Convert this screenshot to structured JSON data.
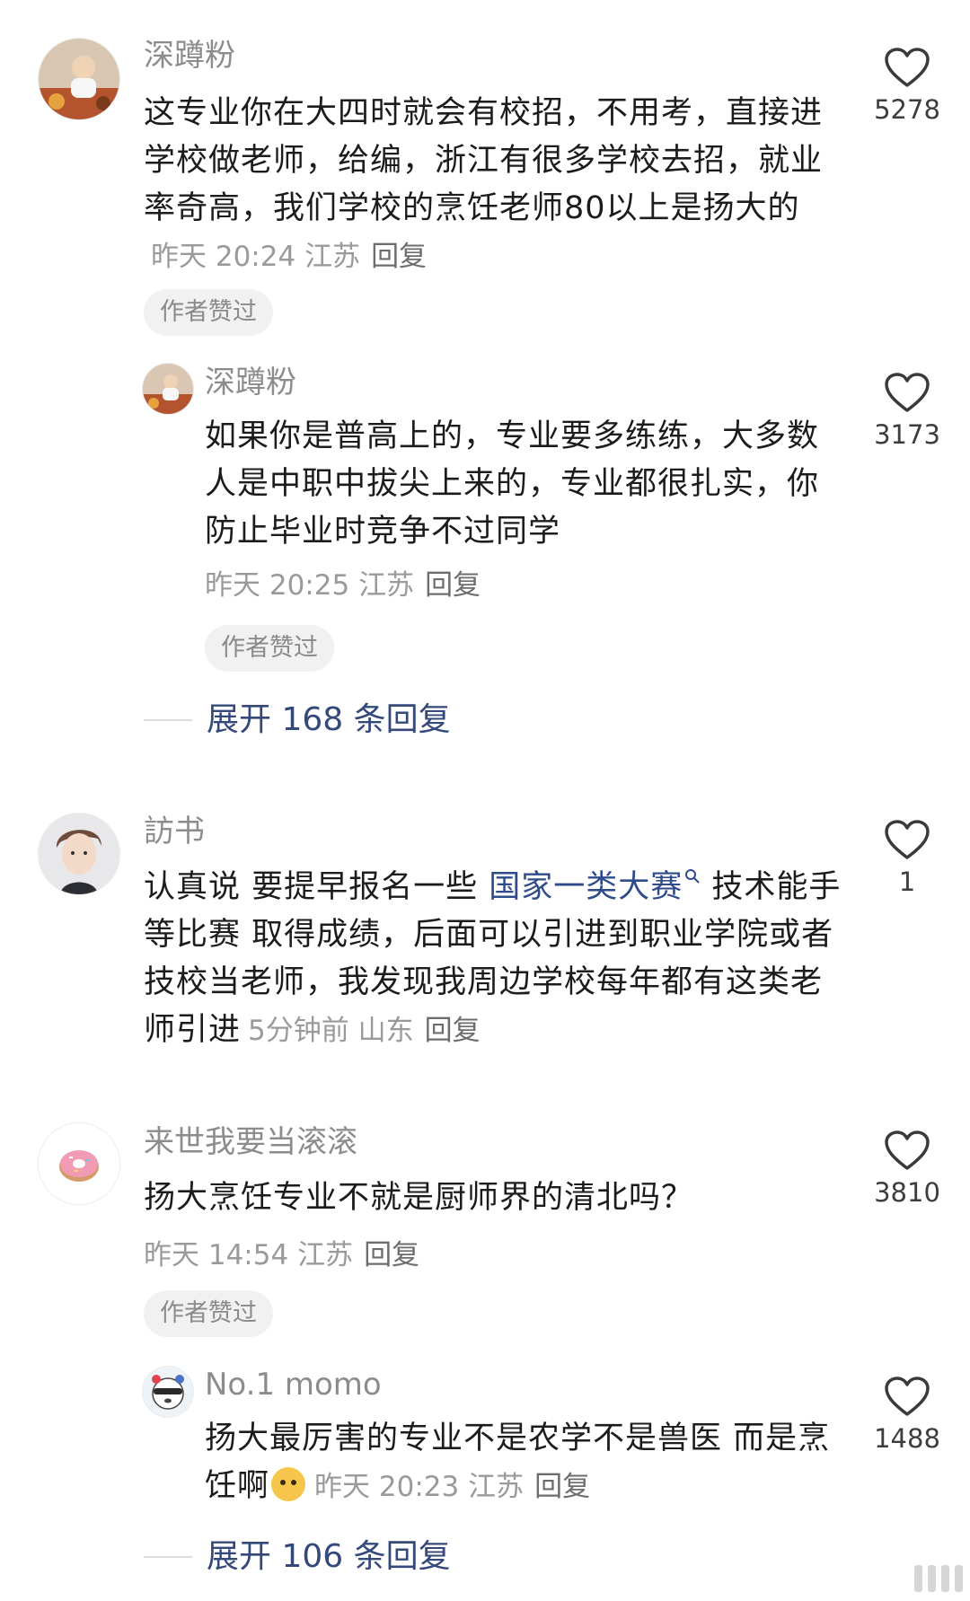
{
  "comments": [
    {
      "username": "深蹲粉",
      "text": "这专业你在大四时就会有校招，不用考，直接进学校做老师，给编，浙江有很多学校去招，就业率奇高，我们学校的烹饪老师80以上是扬大的",
      "time": "昨天 20:24",
      "location": "江苏",
      "reply_label": "回复",
      "badge": "作者赞过",
      "likes": "5278",
      "avatar_icon": "user-photo-avatar",
      "replies": [
        {
          "username": "深蹲粉",
          "text": "如果你是普高上的，专业要多练练，大多数人是中职中拔尖上来的，专业都很扎实，你防止毕业时竞争不过同学",
          "time": "昨天 20:25",
          "location": "江苏",
          "reply_label": "回复",
          "badge": "作者赞过",
          "likes": "3173",
          "avatar_icon": "user-photo-avatar"
        }
      ],
      "expand_label": "展开 168 条回复"
    },
    {
      "username": "訪书",
      "text_before": "认真说 要提早报名一些 ",
      "link_text": "国家一类大赛",
      "text_after": " 技术能手等比赛 取得成绩，后面可以引进到职业学院或者技校当老师，我发现我周边学校每年都有这类老师引进",
      "time": "5分钟前",
      "location": "山东",
      "reply_label": "回复",
      "likes": "1",
      "avatar_icon": "young-man-avatar"
    },
    {
      "username": "来世我要当滚滚",
      "text": "扬大烹饪专业不就是厨师界的清北吗？",
      "time": "昨天 14:54",
      "location": "江苏",
      "reply_label": "回复",
      "badge": "作者赞过",
      "likes": "3810",
      "avatar_icon": "donut-avatar",
      "replies": [
        {
          "username": "No.1 momo",
          "text_before": "扬大最厉害的专业不是农学不是兽医 而是烹饪啊",
          "time": "昨天 20:23",
          "location": "江苏",
          "reply_label": "回复",
          "likes": "1488",
          "avatar_icon": "cartoon-panda-avatar"
        }
      ],
      "expand_label": "展开 106 条回复"
    }
  ],
  "colors": {
    "link": "#2f4b8a",
    "expand": "#34497a",
    "meta": "#9a9a9a",
    "badge_bg": "#f1f1f1"
  }
}
